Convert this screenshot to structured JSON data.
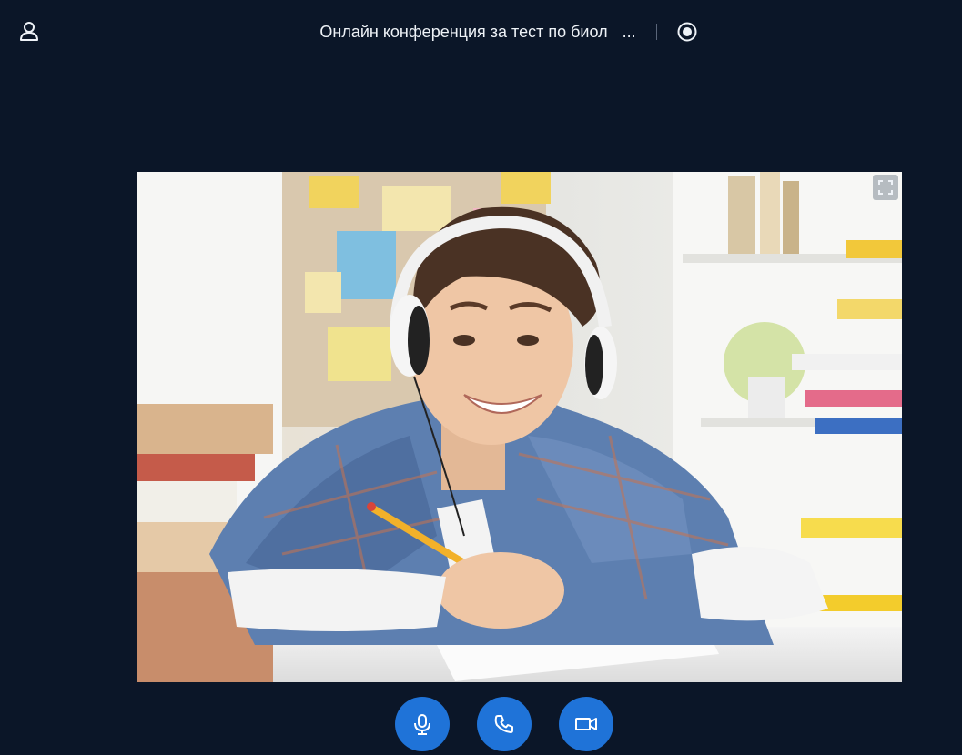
{
  "header": {
    "title": "Онлайн конференция за тест по биол",
    "more_label": "...",
    "user_icon": "user-icon",
    "record_icon": "record-icon"
  },
  "video": {
    "fullscreen_icon": "expand-icon"
  },
  "controls": {
    "microphone_icon": "microphone-icon",
    "call_icon": "phone-icon",
    "camera_icon": "video-camera-icon"
  },
  "colors": {
    "background": "#0b1628",
    "accent": "#1f73d8",
    "text": "#eef2f7"
  }
}
